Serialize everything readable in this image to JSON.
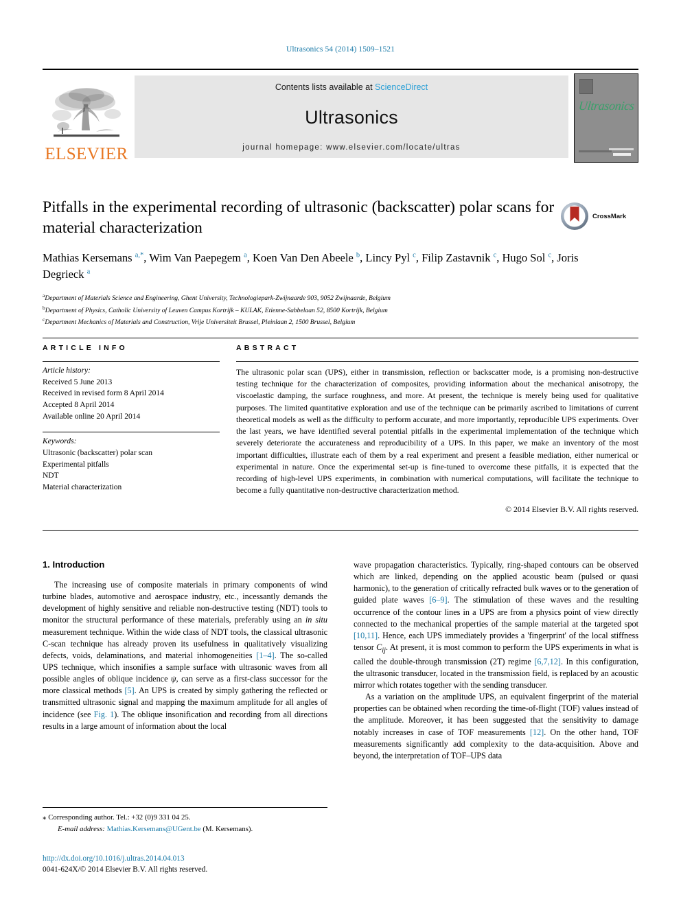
{
  "running_head": "Ultrasonics 54 (2014) 1509–1521",
  "masthead": {
    "publisher_name": "ELSEVIER",
    "contents_prefix": "Contents lists available at",
    "sciencedirect": "ScienceDirect",
    "journal_title": "Ultrasonics",
    "homepage": "journal homepage: www.elsevier.com/locate/ultras",
    "cover_title": "Ultrasonics"
  },
  "article": {
    "title": "Pitfalls in the experimental recording of ultrasonic (backscatter) polar scans for material characterization",
    "crossmark_label": "CrossMark",
    "authors_html": "Mathias Kersemans <sup>a,*</sup>, Wim Van Paepegem <sup>a</sup>, Koen Van Den Abeele <sup>b</sup>, Lincy Pyl <sup>c</sup>, Filip Zastavnik <sup>c</sup>, Hugo Sol <sup>c</sup>, Joris Degrieck <sup>a</sup>",
    "affiliations": [
      "Department of Materials Science and Engineering, Ghent University, Technologiepark-Zwijnaarde 903, 9052 Zwijnaarde, Belgium",
      "Department of Physics, Catholic University of Leuven Campus Kortrijk – KULAK, Etienne-Sabbelaan 52, 8500 Kortrijk, Belgium",
      "Department Mechanics of Materials and Construction, Vrije Universiteit Brussel, Pleinlaan 2, 1500 Brussel, Belgium"
    ],
    "affiliation_marks": [
      "a",
      "b",
      "c"
    ]
  },
  "article_info": {
    "heading": "ARTICLE INFO",
    "history_label": "Article history:",
    "history": [
      "Received 5 June 2013",
      "Received in revised form 8 April 2014",
      "Accepted 8 April 2014",
      "Available online 20 April 2014"
    ],
    "keywords_label": "Keywords:",
    "keywords": [
      "Ultrasonic (backscatter) polar scan",
      "Experimental pitfalls",
      "NDT",
      "Material characterization"
    ]
  },
  "abstract": {
    "heading": "ABSTRACT",
    "text": "The ultrasonic polar scan (UPS), either in transmission, reflection or backscatter mode, is a promising non-destructive testing technique for the characterization of composites, providing information about the mechanical anisotropy, the viscoelastic damping, the surface roughness, and more. At present, the technique is merely being used for qualitative purposes. The limited quantitative exploration and use of the technique can be primarily ascribed to limitations of current theoretical models as well as the difficulty to perform accurate, and more importantly, reproducible UPS experiments. Over the last years, we have identified several potential pitfalls in the experimental implementation of the technique which severely deteriorate the accurateness and reproducibility of a UPS. In this paper, we make an inventory of the most important difficulties, illustrate each of them by a real experiment and present a feasible mediation, either numerical or experimental in nature. Once the experimental set-up is fine-tuned to overcome these pitfalls, it is expected that the recording of high-level UPS experiments, in combination with numerical computations, will facilitate the technique to become a fully quantitative non-destructive characterization method.",
    "copyright": "© 2014 Elsevier B.V. All rights reserved."
  },
  "body": {
    "section_number_title": "1. Introduction",
    "left_paragraphs": [
      {
        "parts": [
          {
            "t": "The increasing use of composite materials in primary components of wind turbine blades, automotive and aerospace industry, etc., incessantly demands the development of highly sensitive and reliable non-destructive testing (NDT) tools to monitor the structural performance of these materials, preferably using an "
          },
          {
            "t": "in situ",
            "style": "italic"
          },
          {
            "t": " measurement technique. Within the wide class of NDT tools, the classical ultrasonic C-scan technique has already proven its usefulness in qualitatively visualizing defects, voids, delaminations, and material inhomogeneities "
          },
          {
            "t": "[1–4]",
            "style": "ref"
          },
          {
            "t": ". The so-called UPS technique, which insonifies a sample surface with ultrasonic waves from all possible angles of oblique incidence "
          },
          {
            "t": "ψ",
            "style": "italic"
          },
          {
            "t": ", can serve as a first-class successor for the more classical methods "
          },
          {
            "t": "[5]",
            "style": "ref"
          },
          {
            "t": ". An UPS is created by simply gathering the reflected or transmitted ultrasonic signal and mapping the maximum amplitude for all angles of incidence (see "
          },
          {
            "t": "Fig. 1",
            "style": "ref"
          },
          {
            "t": "). The oblique insonification and recording from all directions results in a large amount of information about the local"
          }
        ]
      }
    ],
    "right_paragraphs": [
      {
        "indent": false,
        "parts": [
          {
            "t": "wave propagation characteristics. Typically, ring-shaped contours can be observed which are linked, depending on the applied acoustic beam (pulsed or quasi harmonic), to the generation of critically refracted bulk waves or to the generation of guided plate waves "
          },
          {
            "t": "[6–9]",
            "style": "ref"
          },
          {
            "t": ". The stimulation of these waves and the resulting occurrence of the contour lines in a UPS are from a physics point of view directly connected to the mechanical properties of the sample material at the targeted spot "
          },
          {
            "t": "[10,11]",
            "style": "ref"
          },
          {
            "t": ". Hence, each UPS immediately provides a 'fingerprint' of the local stiffness tensor "
          },
          {
            "t": "C",
            "style": "italic"
          },
          {
            "t": "ij",
            "style": "sub-italic"
          },
          {
            "t": ". At present, it is most common to perform the UPS experiments in what is called the double-through transmission (2T) regime "
          },
          {
            "t": "[6,7,12]",
            "style": "ref"
          },
          {
            "t": ". In this configuration, the ultrasonic transducer, located in the transmission field, is replaced by an acoustic mirror which rotates together with the sending transducer."
          }
        ]
      },
      {
        "indent": true,
        "parts": [
          {
            "t": "As a variation on the amplitude UPS, an equivalent fingerprint of the material properties can be obtained when recording the time-of-flight (TOF) values instead of the amplitude. Moreover, it has been suggested that the sensitivity to damage notably increases in case of TOF measurements "
          },
          {
            "t": "[12]",
            "style": "ref"
          },
          {
            "t": ". On the other hand, TOF measurements significantly add complexity to the data-acquisition. Above and beyond, the interpretation of TOF–UPS data"
          }
        ]
      }
    ]
  },
  "footnotes": {
    "corresponding": "Corresponding author. Tel.: +32 (0)9 331 04 25.",
    "email_label": "E-mail address:",
    "email": "Mathias.Kersemans@UGent.be",
    "email_suffix": "(M. Kersemans).",
    "doi": "http://dx.doi.org/10.1016/j.ultras.2014.04.013",
    "issn": "0041-624X/© 2014 Elsevier B.V. All rights reserved."
  },
  "colors": {
    "link_blue": "#1a7aa8",
    "sciencedirect_blue": "#2a9fd6",
    "elsevier_orange": "#E87722",
    "cover_gray": "#8e8e8e",
    "cover_green": "#39a06a",
    "band_gray": "#e6e6e6"
  }
}
